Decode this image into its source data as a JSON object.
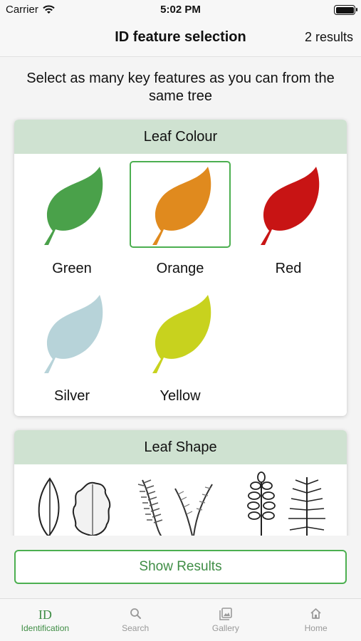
{
  "status": {
    "carrier": "Carrier",
    "time": "5:02 PM"
  },
  "nav": {
    "title": "ID feature selection",
    "results": "2 results"
  },
  "instructions": "Select as many key features as you can from the same tree",
  "leaf_colour": {
    "title": "Leaf Colour",
    "options": [
      {
        "label": "Green",
        "color": "#4aa14a",
        "selected": false
      },
      {
        "label": "Orange",
        "color": "#e08a1e",
        "selected": true
      },
      {
        "label": "Red",
        "color": "#c81414",
        "selected": false
      },
      {
        "label": "Silver",
        "color": "#b7d3d9",
        "selected": false
      },
      {
        "label": "Yellow",
        "color": "#c8d21e",
        "selected": false
      }
    ]
  },
  "leaf_shape": {
    "title": "Leaf Shape"
  },
  "show_results_label": "Show Results",
  "tabs": [
    {
      "label": "Identification",
      "icon": "ID",
      "active": true
    },
    {
      "label": "Search",
      "icon": "search-icon",
      "active": false
    },
    {
      "label": "Gallery",
      "icon": "gallery-icon",
      "active": false
    },
    {
      "label": "Home",
      "icon": "home-icon",
      "active": false
    }
  ],
  "colors": {
    "accent": "#3f8d45",
    "border": "#4caf50",
    "header_bg": "#cfe2d1"
  }
}
